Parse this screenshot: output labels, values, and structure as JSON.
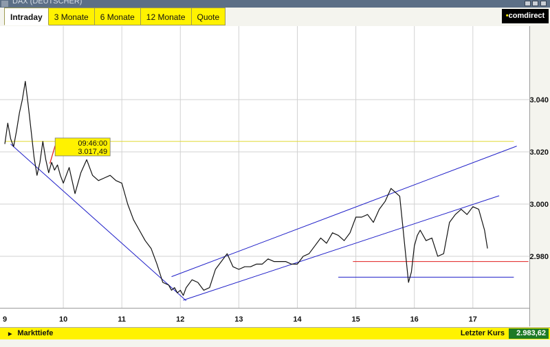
{
  "window": {
    "title": "DAX (DEUTSCHER)"
  },
  "tabs": [
    {
      "label": "Intraday",
      "active": true
    },
    {
      "label": "3 Monate",
      "active": false
    },
    {
      "label": "6 Monate",
      "active": false
    },
    {
      "label": "12 Monate",
      "active": false
    },
    {
      "label": "Quote",
      "active": false
    }
  ],
  "logo": {
    "text": "comdirect"
  },
  "chart_data": {
    "type": "line",
    "x_ticks": [
      "9",
      "10",
      "11",
      "12",
      "13",
      "14",
      "15",
      "16",
      "17"
    ],
    "y_ticks": [
      "3.040",
      "3.020",
      "3.000",
      "2.980"
    ],
    "xlim": [
      9,
      18.3
    ],
    "ylim": [
      2.9575,
      3.0665
    ],
    "grid": true,
    "tooltip": {
      "time": "09:46:00",
      "value": "3.017,49"
    },
    "x": [
      9.0,
      9.05,
      9.1,
      9.15,
      9.2,
      9.25,
      9.3,
      9.35,
      9.4,
      9.45,
      9.5,
      9.55,
      9.6,
      9.65,
      9.7,
      9.75,
      9.8,
      9.85,
      9.9,
      9.95,
      10.0,
      10.1,
      10.2,
      10.3,
      10.4,
      10.5,
      10.6,
      10.7,
      10.8,
      10.9,
      11.0,
      11.1,
      11.2,
      11.3,
      11.4,
      11.5,
      11.6,
      11.7,
      11.8,
      11.85,
      11.9,
      11.95,
      12.0,
      12.05,
      12.1,
      12.2,
      12.3,
      12.4,
      12.5,
      12.6,
      12.7,
      12.8,
      12.9,
      13.0,
      13.1,
      13.2,
      13.3,
      13.4,
      13.5,
      13.6,
      13.7,
      13.8,
      13.9,
      14.0,
      14.1,
      14.2,
      14.3,
      14.4,
      14.5,
      14.6,
      14.7,
      14.8,
      14.9,
      15.0,
      15.1,
      15.2,
      15.3,
      15.4,
      15.5,
      15.6,
      15.7,
      15.75,
      15.8,
      15.85,
      15.9,
      15.95,
      16.0,
      16.05,
      16.1,
      16.2,
      16.3,
      16.4,
      16.5,
      16.6,
      16.7,
      16.8,
      16.9,
      17.0,
      17.1,
      17.2,
      17.25
    ],
    "values": [
      3.023,
      3.031,
      3.025,
      3.022,
      3.028,
      3.035,
      3.04,
      3.047,
      3.038,
      3.028,
      3.018,
      3.011,
      3.016,
      3.024,
      3.017,
      3.012,
      3.016,
      3.013,
      3.015,
      3.011,
      3.008,
      3.014,
      3.004,
      3.012,
      3.017,
      3.011,
      3.009,
      3.01,
      3.011,
      3.009,
      3.008,
      3.0,
      2.994,
      2.99,
      2.986,
      2.983,
      2.977,
      2.97,
      2.969,
      2.967,
      2.968,
      2.966,
      2.967,
      2.965,
      2.968,
      2.971,
      2.97,
      2.967,
      2.968,
      2.975,
      2.978,
      2.981,
      2.976,
      2.975,
      2.976,
      2.976,
      2.977,
      2.977,
      2.979,
      2.978,
      2.978,
      2.978,
      2.977,
      2.977,
      2.98,
      2.981,
      2.984,
      2.987,
      2.985,
      2.989,
      2.988,
      2.986,
      2.989,
      2.995,
      2.995,
      2.996,
      2.993,
      2.998,
      3.001,
      3.006,
      3.004,
      3.003,
      2.992,
      2.981,
      2.97,
      2.974,
      2.984,
      2.988,
      2.99,
      2.986,
      2.987,
      2.98,
      2.981,
      2.993,
      2.996,
      2.998,
      2.996,
      2.999,
      2.998,
      2.99,
      2.983
    ],
    "trendlines": [
      {
        "color": "#1e1ec8",
        "x": [
          9.1,
          12.1
        ],
        "y": [
          3.023,
          2.963
        ]
      },
      {
        "color": "#1e1ec8",
        "x": [
          11.85,
          17.75
        ],
        "y": [
          2.9722,
          3.0222
        ]
      },
      {
        "color": "#1e1ec8",
        "x": [
          12.05,
          17.45
        ],
        "y": [
          2.9632,
          3.0032
        ]
      },
      {
        "color": "#1e1ec8",
        "x": [
          14.7,
          17.7
        ],
        "y": [
          2.972,
          2.972
        ]
      },
      {
        "color": "#e01b1b",
        "x": [
          14.95,
          17.95
        ],
        "y": [
          2.978,
          2.978
        ]
      },
      {
        "color": "#e0d830",
        "x": [
          9.0,
          17.7
        ],
        "y": [
          3.024,
          3.024
        ]
      }
    ]
  },
  "bottom": {
    "markttiefe_label": "Markttiefe",
    "letzter_kurs_label": "Letzter Kurs",
    "letzter_kurs_value": "2.983,62"
  },
  "colors": {
    "accent_yellow": "#fff200",
    "trend_blue": "#1e1ec8",
    "support_red": "#e01b1b",
    "last_price_green": "#1e7a26"
  }
}
